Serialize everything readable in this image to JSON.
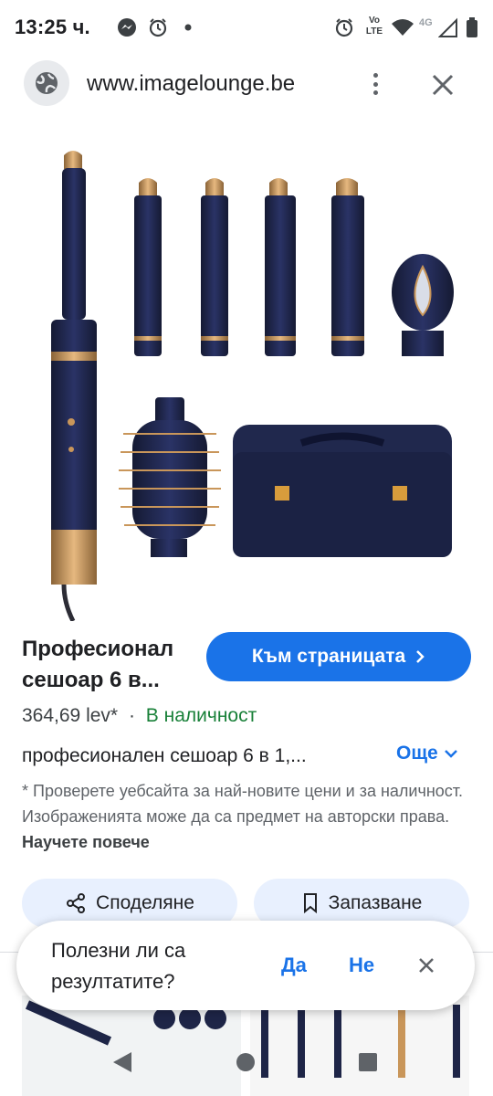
{
  "status_bar": {
    "time": "13:25 ч.",
    "icons": [
      "messenger-icon",
      "alarm-icon",
      "dot-icon",
      "alarm-icon",
      "volte-icon",
      "wifi-icon",
      "signal-4g-icon",
      "signal-icon",
      "battery-icon"
    ],
    "volte_top": "Vo",
    "volte_bottom": "LTE",
    "network": "4G"
  },
  "browser": {
    "url": "www.imagelounge.be"
  },
  "product": {
    "title_line1": "Професионал",
    "title_line2": "сешоар 6 в...",
    "visit_button": "Към страницата",
    "price": "364,69 lev*",
    "separator": "·",
    "availability": "В наличност",
    "description": "професионален сешоар 6 в 1,...",
    "more": "Още",
    "disclaimer": "* Проверете уебсайта за най-новите цени и за наличност. Изображенията може да са предмет на авторски права.",
    "learn_more": "Научете повече"
  },
  "actions": {
    "share": "Споделяне",
    "save": "Запазване"
  },
  "feedback": {
    "question": "Полезни ли са резултатите?",
    "yes": "Да",
    "no": "Не"
  },
  "colors": {
    "accent": "#1a73e8",
    "stock": "#188038",
    "product_navy": "#1e2547",
    "product_gold": "#c9965a"
  }
}
